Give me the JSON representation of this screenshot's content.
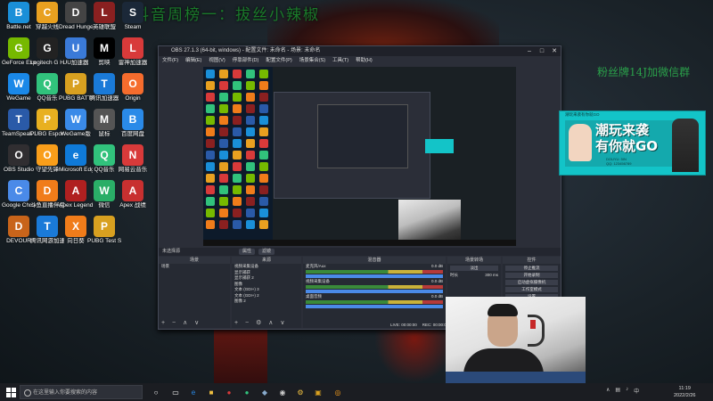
{
  "overlay": {
    "title": "抖音周榜一：拔丝小辣椒",
    "fans": "粉丝牌14J加微信群"
  },
  "desktop_icons": [
    {
      "label": "Battle.net",
      "color": "#1a8fd8",
      "glyph": "B"
    },
    {
      "label": "穿越火线",
      "color": "#e8a020",
      "glyph": "C"
    },
    {
      "label": "Dread Hunger",
      "color": "#444",
      "glyph": "D"
    },
    {
      "label": "英雄联盟",
      "color": "#8a2020",
      "glyph": "L"
    },
    {
      "label": "Steam",
      "color": "#1b2838",
      "glyph": "S"
    },
    {
      "label": "GeForce Experience",
      "color": "#76b900",
      "glyph": "G"
    },
    {
      "label": "Logitech G HUB",
      "color": "#222",
      "glyph": "G"
    },
    {
      "label": "UU加速器",
      "color": "#3a7ad8",
      "glyph": "U"
    },
    {
      "label": "剪映",
      "color": "#000",
      "glyph": "M"
    },
    {
      "label": "雷神加速器",
      "color": "#d83a3a",
      "glyph": "L"
    },
    {
      "label": "WeGame",
      "color": "#1a88e8",
      "glyph": "W"
    },
    {
      "label": "QQ音乐",
      "color": "#31c27c",
      "glyph": "Q"
    },
    {
      "label": "PUBG BATTLEGROUNDS",
      "color": "#d8a020",
      "glyph": "P"
    },
    {
      "label": "腾讯加速器",
      "color": "#1a7ad8",
      "glyph": "T"
    },
    {
      "label": "Origin",
      "color": "#f56c2d",
      "glyph": "O"
    },
    {
      "label": "TeamSpeak 3",
      "color": "#2a5aa8",
      "glyph": "T"
    },
    {
      "label": "PUBG Esports",
      "color": "#e8b020",
      "glyph": "P"
    },
    {
      "label": "WeGame版",
      "color": "#3a8ae8",
      "glyph": "W"
    },
    {
      "label": "鼠标",
      "color": "#555",
      "glyph": "M"
    },
    {
      "label": "百度网盘",
      "color": "#2a8ae8",
      "glyph": "B"
    },
    {
      "label": "OBS Studio",
      "color": "#302e31",
      "glyph": "O"
    },
    {
      "label": "守望先锋",
      "color": "#f99e1a",
      "glyph": "O"
    },
    {
      "label": "Microsoft Edge",
      "color": "#0f7ad8",
      "glyph": "e"
    },
    {
      "label": "QQ音乐",
      "color": "#31c27c",
      "glyph": "Q"
    },
    {
      "label": "网易云音乐",
      "color": "#d83a3a",
      "glyph": "N"
    },
    {
      "label": "Google Chrome",
      "color": "#4a8ae8",
      "glyph": "C"
    },
    {
      "label": "斗鱼直播伴侣",
      "color": "#f07c1a",
      "glyph": "D"
    },
    {
      "label": "Apex Legends",
      "color": "#b02020",
      "glyph": "A"
    },
    {
      "label": "微信",
      "color": "#2aae67",
      "glyph": "W"
    },
    {
      "label": "Apex 战绩",
      "color": "#c83030",
      "glyph": "A"
    },
    {
      "label": "DEVOUR",
      "color": "#c8641a",
      "glyph": "D"
    },
    {
      "label": "腾讯网游加速器",
      "color": "#1a7ad8",
      "glyph": "T"
    },
    {
      "label": "向日葵",
      "color": "#f07c1a",
      "glyph": "X"
    },
    {
      "label": "PUBG Test Server",
      "color": "#d8a020",
      "glyph": "P"
    }
  ],
  "obs": {
    "title": "OBS 27.1.3 (64-bit, windows) - 配置文件: 未命名 - 场景: 未命名",
    "menu": [
      "文件(F)",
      "编辑(E)",
      "视图(V)",
      "停靠部件(D)",
      "配置文件(P)",
      "场景集合(S)",
      "工具(T)",
      "帮助(H)"
    ],
    "scene_label": "未选择源",
    "prop_button": "属性",
    "filter_button": "滤镜",
    "docks": {
      "scenes": {
        "title": "场景",
        "items": [
          "场景"
        ]
      },
      "sources": {
        "title": "来源",
        "items": [
          "视频采集设备",
          "显示捕获",
          "显示捕获 2",
          "图像",
          "文本 (GDI+) 3",
          "文本 (GDI+) 2",
          "图像 2"
        ]
      },
      "mixer": {
        "title": "混音器",
        "tracks": [
          {
            "name": "麦克风/Aux",
            "level": "0.0 dB"
          },
          {
            "name": "视频采集设备",
            "level": "0.0 dB"
          },
          {
            "name": "桌面音频",
            "level": "0.0 dB"
          }
        ]
      },
      "transitions": {
        "title": "场景转场",
        "type": "淡出",
        "duration_label": "时长",
        "duration": "300 ms"
      },
      "controls": {
        "title": "控件",
        "buttons": [
          "停止推流",
          "开始录制",
          "启动虚拟摄像机",
          "工作室模式",
          "设置",
          "退出"
        ]
      }
    },
    "status": [
      "LIVE: 00:00:00",
      "REC: 00:00:00",
      "CPU: 3.5%, 60.00 fps"
    ]
  },
  "banner": {
    "top": "潮玩来袭有你就GO",
    "line1": "潮玩来袭",
    "line2": "有你就GO",
    "sub1": "DOUYU: 5IN",
    "sub2": "QQ: 123456789"
  },
  "taskbar": {
    "search_placeholder": "在这里输入你要搜索的内容",
    "time": "11:19",
    "date": "2022/2/26"
  }
}
